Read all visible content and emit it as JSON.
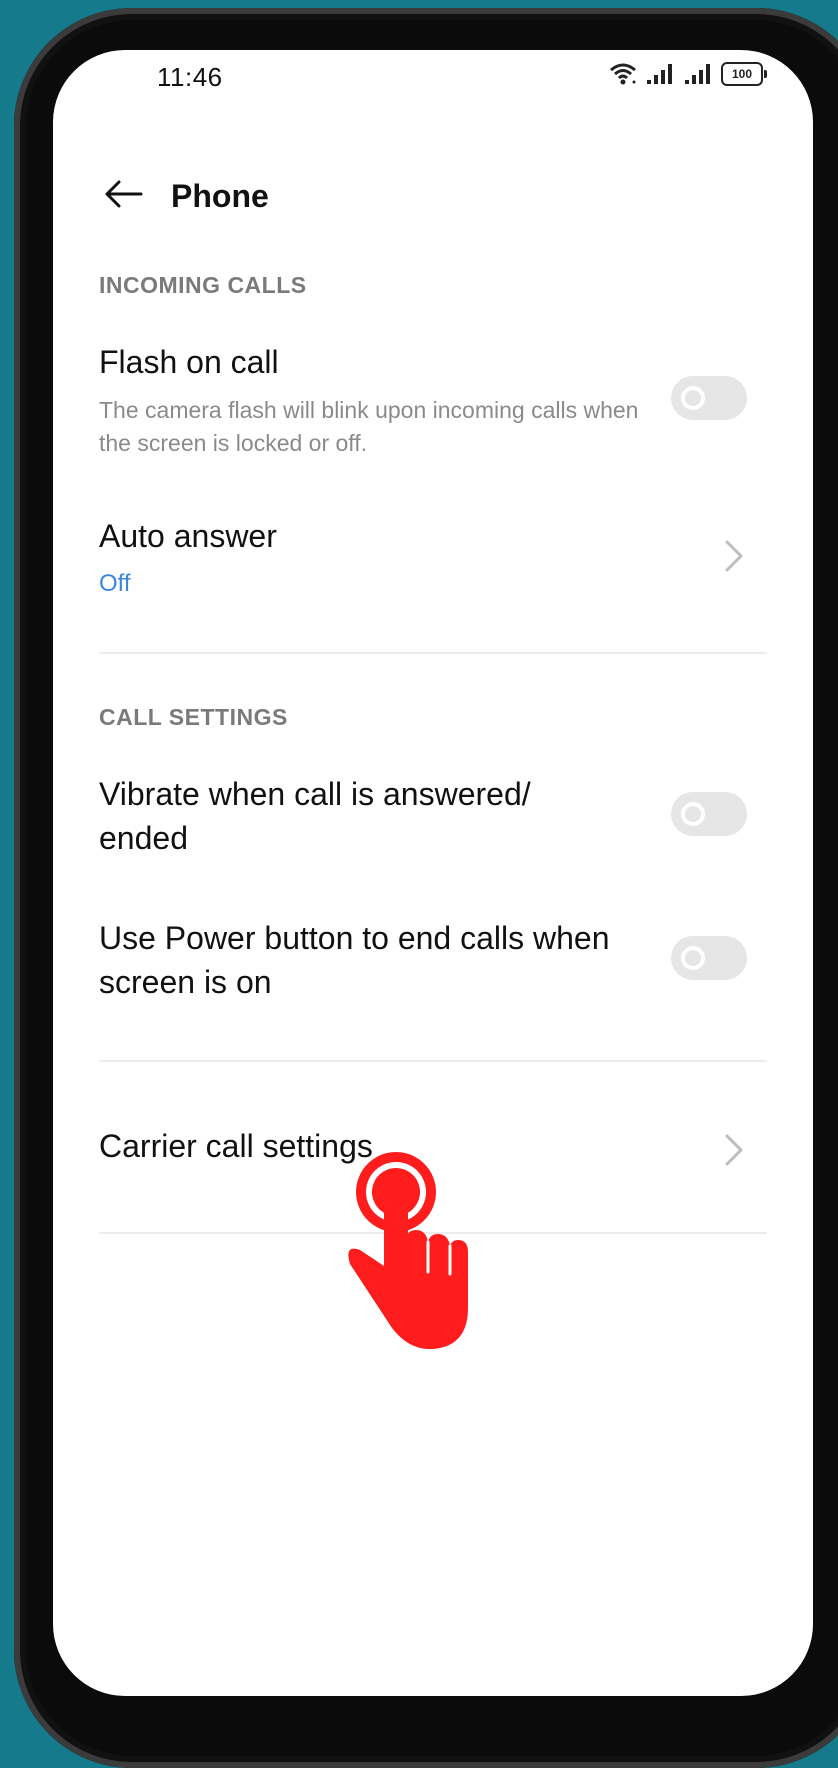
{
  "status_bar": {
    "time": "11:46",
    "battery": "100",
    "icons": [
      "wifi-icon",
      "signal-icon",
      "signal-icon",
      "battery-icon"
    ]
  },
  "header": {
    "title": "Phone",
    "back_icon": "arrow-left-icon"
  },
  "sections": {
    "incoming_calls": "INCOMING CALLS",
    "call_settings": "CALL SETTINGS"
  },
  "settings": {
    "flash_on_call": {
      "title": "Flash on call",
      "subtitle": "The camera flash will blink upon incoming calls when the screen is locked or off.",
      "enabled": false
    },
    "auto_answer": {
      "title": "Auto answer",
      "value": "Off"
    },
    "vibrate_on_answer": {
      "title": "Vibrate when call is answered/ ended",
      "enabled": false
    },
    "power_button_end_call": {
      "title": "Use Power button to end calls when screen is on",
      "enabled": false
    },
    "carrier_call_settings": {
      "title": "Carrier call settings"
    }
  },
  "colors": {
    "background": "#157a8c",
    "accent": "#3a86e0",
    "toggle_off": "#e6e6e6",
    "touch_indicator": "#ff1c1c"
  },
  "overlay": {
    "icon": "tap-hand-icon"
  }
}
